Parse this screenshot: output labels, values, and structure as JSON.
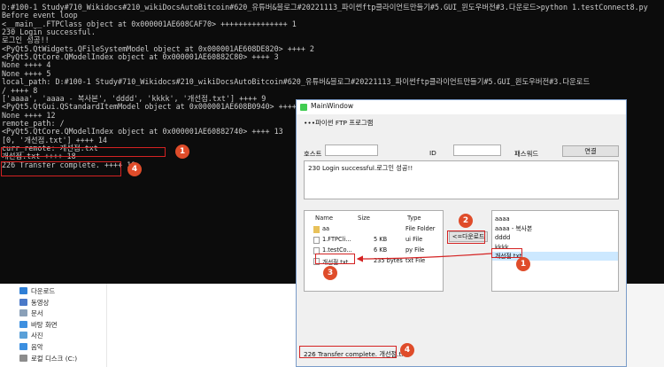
{
  "console": {
    "lines": [
      "D:#100-1 Study#710_Wikidocs#210_wikiDocsAutoBitcoin#620_유튜버&블로그#20221113_파이썬ftp클라이언트만들기#5.GUI_윈도우버전#3.다운로드>python 1.testConnect8.py",
      "Before event loop",
      "<__main__.FTPClass object at 0x000001AE608CAF70> +++++++++++++++ 1",
      "230 Login successful.",
      "로그인 성공!!",
      "<PyQt5.QtWidgets.QFileSystemModel object at 0x000001AE608DE820> ++++ 2",
      "<PyQt5.QtCore.QModelIndex object at 0x000001AE60882C80> ++++ 3",
      "None ++++ 4",
      "None ++++ 5",
      "local_path: D:#100-1 Study#710_Wikidocs#210_wikiDocsAutoBitcoin#620_유튜버&블로그#20221113_파이썬ftp클라이언트만들기#5.GUI_윈도우버전#3.다운로드",
      "/ ++++ 8",
      "['aaaa', 'aaaa - 복사본', 'dddd', 'kkkk', '개선점.txt'] ++++ 9",
      "<PyQt5.QtGui.QStandardItemModel object at 0x000001AE608B0940> ++++ 10",
      "None ++++ 12",
      "remote_path: /",
      "<PyQt5.QtCore.QModelIndex object at 0x000001AE60882740> ++++ 13",
      "[0, '개선점.txt'] ++++ 14",
      "curr_remote: 개선점.txt",
      "개선점.txt ++++ 18",
      "226 Transfer complete. ++++ 19"
    ]
  },
  "explorer": {
    "nav": [
      {
        "label": "다운로드",
        "icon": "download-folder-icon",
        "color": "#2f7fd6"
      },
      {
        "label": "동영상",
        "icon": "video-folder-icon",
        "color": "#4a79c8"
      },
      {
        "label": "문서",
        "icon": "documents-folder-icon",
        "color": "#8aa0b8"
      },
      {
        "label": "바탕 화면",
        "icon": "desktop-folder-icon",
        "color": "#3e90e0"
      },
      {
        "label": "사진",
        "icon": "pictures-folder-icon",
        "color": "#5aa0d8"
      },
      {
        "label": "음악",
        "icon": "music-folder-icon",
        "color": "#3b8fe0"
      },
      {
        "label": "로컬 디스크 (C:)",
        "icon": "drive-icon",
        "color": "#8c8c8c"
      }
    ]
  },
  "window": {
    "title": "MainWindow",
    "heading": "•••파이썬 FTP 프로그램",
    "host_label": "호스트",
    "id_label": "ID",
    "password_label": "패스워드",
    "connect_button": "연결",
    "log_text": "230 Login successful.로그인 성공!!",
    "download_button": "<=다운로드",
    "tree": {
      "headers": {
        "name": "Name",
        "size": "Size",
        "type": "Type"
      },
      "rows": [
        {
          "name": "aa",
          "size": "",
          "type": "File Folder",
          "icon": "folder-icon"
        },
        {
          "name": "1.FTPCli...",
          "size": "5 KB",
          "type": "ui File",
          "icon": "file-icon"
        },
        {
          "name": "1.testCo...",
          "size": "6 KB",
          "type": "py File",
          "icon": "python-file-icon"
        },
        {
          "name": "개선점.txt",
          "size": "235 bytes",
          "type": "txt File",
          "icon": "text-file-icon"
        }
      ]
    },
    "remote_list": [
      "aaaa",
      "aaaa - 복사본",
      "dddd",
      "kkkk",
      "개선점.txt"
    ],
    "status_text": "226 Transfer complete. 개선점.txt"
  },
  "markers": [
    "1",
    "4",
    "2",
    "1",
    "3",
    "4"
  ],
  "colors": {
    "annotation_red": "#d42222",
    "marker_fill": "#df4c2a",
    "selection": "#cce8ff",
    "console_bg": "#0c0c0c",
    "console_text": "#cccccc"
  }
}
